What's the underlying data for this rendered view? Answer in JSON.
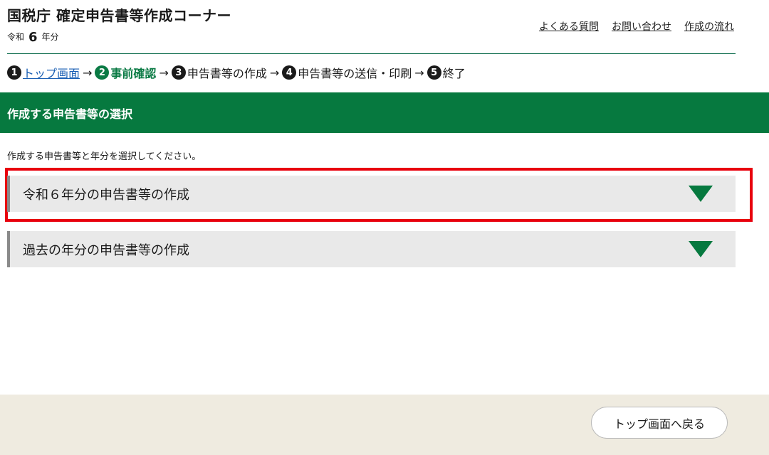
{
  "header": {
    "title": "国税庁 確定申告書等作成コーナー",
    "era_prefix": "令和",
    "era_year": "6",
    "era_suffix": "年分",
    "links": [
      "よくある質問",
      "お問い合わせ",
      "作成の流れ"
    ]
  },
  "steps": [
    {
      "num": "1",
      "label": "トップ画面"
    },
    {
      "num": "2",
      "label": "事前確認"
    },
    {
      "num": "3",
      "label": "申告書等の作成"
    },
    {
      "num": "4",
      "label": "申告書等の送信・印刷"
    },
    {
      "num": "5",
      "label": "終了"
    }
  ],
  "arrow": "→",
  "section": {
    "title": "作成する申告書等の選択",
    "instruction": "作成する申告書等と年分を選択してください。"
  },
  "accordions": [
    {
      "label": "令和６年分の申告書等の作成"
    },
    {
      "label": "過去の年分の申告書等の作成"
    }
  ],
  "footer": {
    "back_button": "トップ画面へ戻る"
  },
  "colors": {
    "accent_green": "#06793f",
    "highlight_red": "#e8000d",
    "footer_bg": "#efebe0"
  }
}
